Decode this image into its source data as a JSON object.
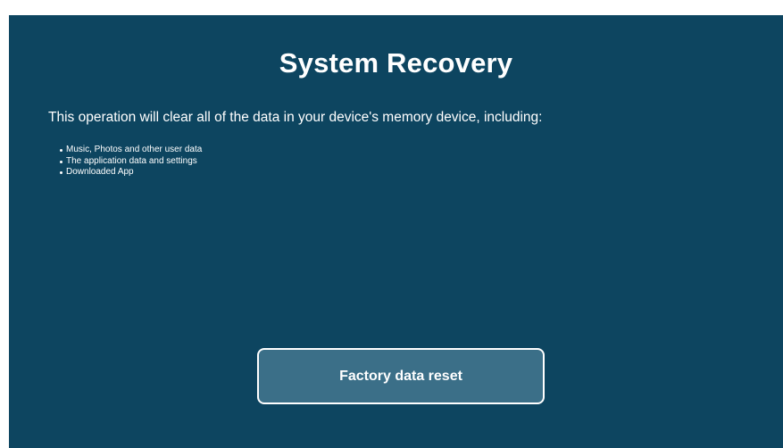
{
  "screen": {
    "title": "System Recovery",
    "intro_text": "This operation will clear all of the data in your device's memory device, including:",
    "bullets": [
      "Music, Photos and other user data",
      "The application data and settings",
      "Downloaded App"
    ],
    "reset_button_label": "Factory data reset"
  },
  "colors": {
    "background": "#0d4560",
    "button_fill": "#3b6f88",
    "text": "#ffffff"
  }
}
